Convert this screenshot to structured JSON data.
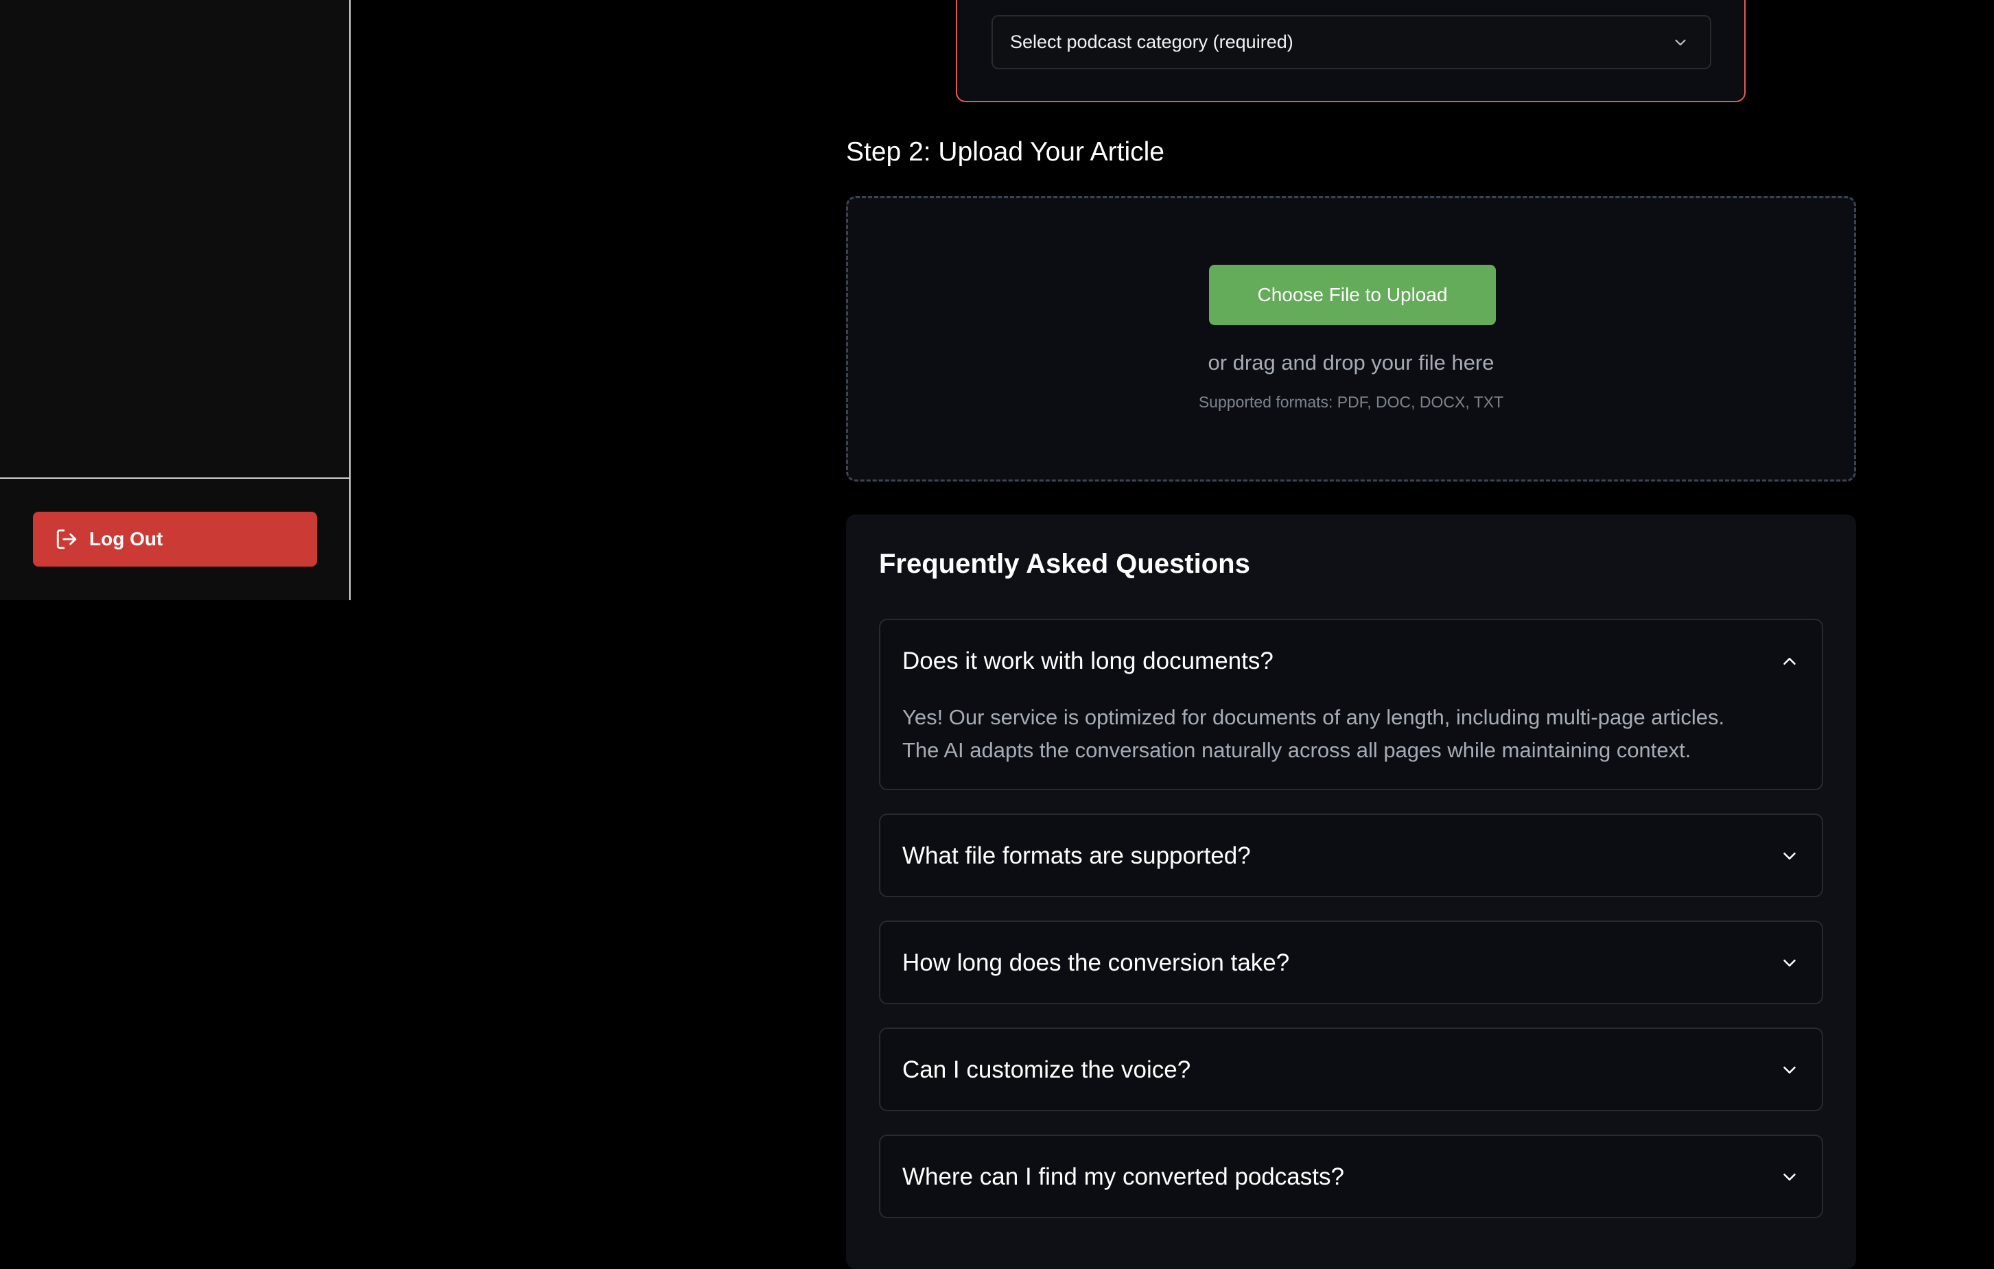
{
  "sidebar": {
    "logout_label": "Log Out"
  },
  "category": {
    "select_label": "Select podcast category (required)"
  },
  "upload": {
    "step_title": "Step 2: Upload Your Article",
    "choose_button_label": "Choose File to Upload",
    "drag_text": "or drag and drop your file here",
    "formats_text": "Supported formats: PDF, DOC, DOCX, TXT"
  },
  "faq": {
    "title": "Frequently Asked Questions",
    "items": [
      {
        "question": "Does it work with long documents?",
        "expanded": true,
        "answer_lines": [
          "Yes! Our service is optimized for documents of any length, including multi-page articles.",
          "The AI adapts the conversation naturally across all pages while maintaining context."
        ]
      },
      {
        "question": "What file formats are supported?",
        "expanded": false
      },
      {
        "question": "How long does the conversion take?",
        "expanded": false
      },
      {
        "question": "Can I customize the voice?",
        "expanded": false
      },
      {
        "question": "Where can I find my converted podcasts?",
        "expanded": false
      }
    ]
  },
  "colors": {
    "logout_button": "#cc3a35",
    "upload_button": "#64ab5a",
    "required_border": "#e05a5e"
  },
  "icons": {
    "logout": "logout-icon",
    "select": "chevron-down-icon",
    "faq_expanded": "chevron-up-icon",
    "faq_collapsed": "chevron-down-icon"
  }
}
